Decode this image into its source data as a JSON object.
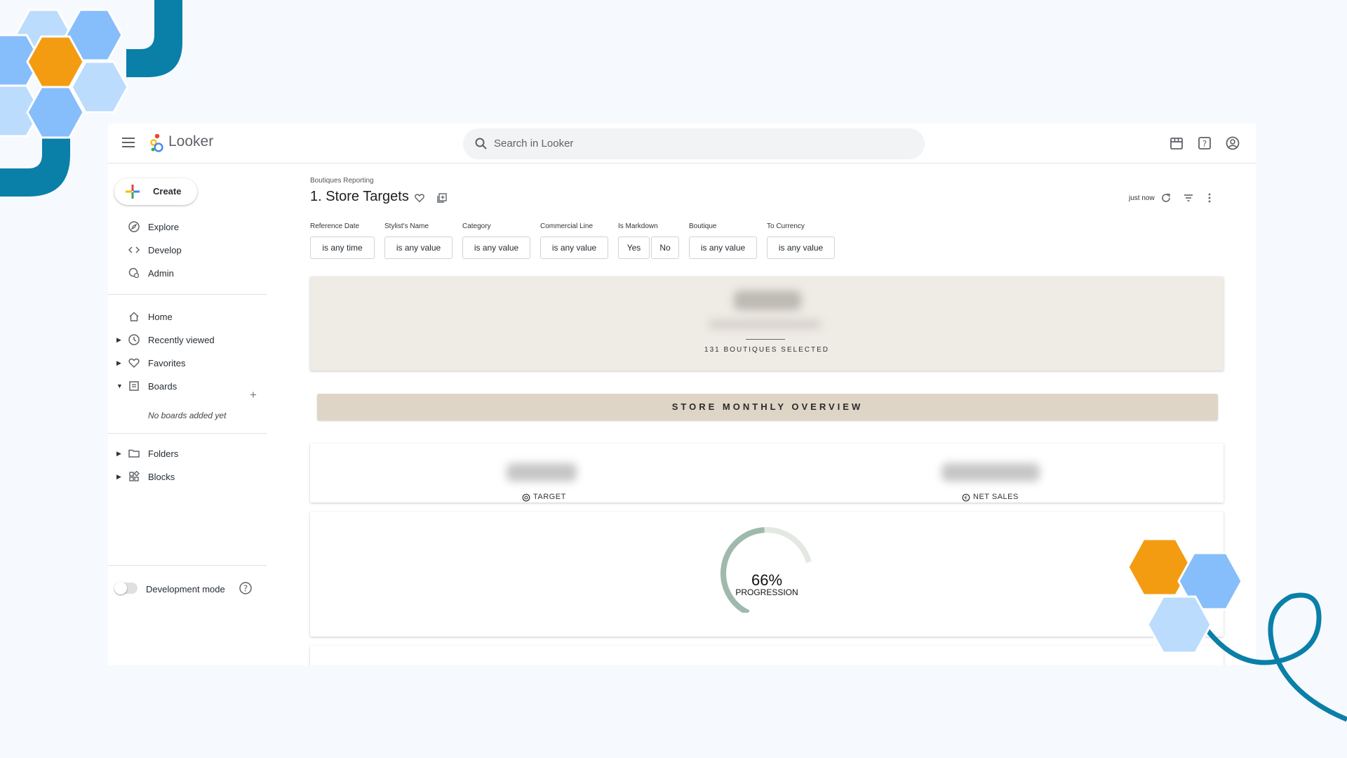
{
  "app": {
    "name": "Looker"
  },
  "search": {
    "placeholder": "Search in Looker"
  },
  "sidebar": {
    "create_label": "Create",
    "top_items": [
      {
        "label": "Explore",
        "icon": "compass-icon"
      },
      {
        "label": "Develop",
        "icon": "code-icon"
      },
      {
        "label": "Admin",
        "icon": "admin-gear-icon"
      }
    ],
    "items": [
      {
        "label": "Home",
        "icon": "home-icon"
      },
      {
        "label": "Recently viewed",
        "icon": "clock-icon"
      },
      {
        "label": "Favorites",
        "icon": "heart-icon"
      },
      {
        "label": "Boards",
        "icon": "board-icon"
      }
    ],
    "no_boards": "No boards added yet",
    "bottom_items": [
      {
        "label": "Folders",
        "icon": "folder-icon"
      },
      {
        "label": "Blocks",
        "icon": "blocks-icon"
      }
    ],
    "dev_mode_label": "Development mode"
  },
  "dashboard": {
    "breadcrumb": "Boutiques Reporting",
    "title": "1. Store Targets",
    "updated": "just now",
    "filters": [
      {
        "label": "Reference Date",
        "value": "is any time"
      },
      {
        "label": "Stylist's Name",
        "value": "is any value"
      },
      {
        "label": "Category",
        "value": "is any value"
      },
      {
        "label": "Commercial Line",
        "value": "is any value"
      },
      {
        "label": "Is Markdown",
        "values": [
          "Yes",
          "No"
        ]
      },
      {
        "label": "Boutique",
        "value": "is any value"
      },
      {
        "label": "To Currency",
        "value": "is any value"
      }
    ],
    "summary_caption": "131 BOUTIQUES SELECTED",
    "section_title": "STORE MONTHLY OVERVIEW",
    "kpis": [
      {
        "label": "TARGET",
        "icon": "target-icon"
      },
      {
        "label": "NET SALES",
        "icon": "currency-icon"
      }
    ],
    "gauge": {
      "value": "66%",
      "fraction": 0.66,
      "label": "PROGRESSION"
    }
  },
  "colors": {
    "accent_orange": "#f39c12",
    "hex_blue": "#86bdfb",
    "hex_light_blue": "#bcdcfd",
    "teal_line": "#0a7fa8",
    "gauge_fill": "#9fb9ac",
    "gauge_track": "#e3e8e3",
    "summary_bg": "#efebe5",
    "banner_bg": "#dfd5c6"
  }
}
